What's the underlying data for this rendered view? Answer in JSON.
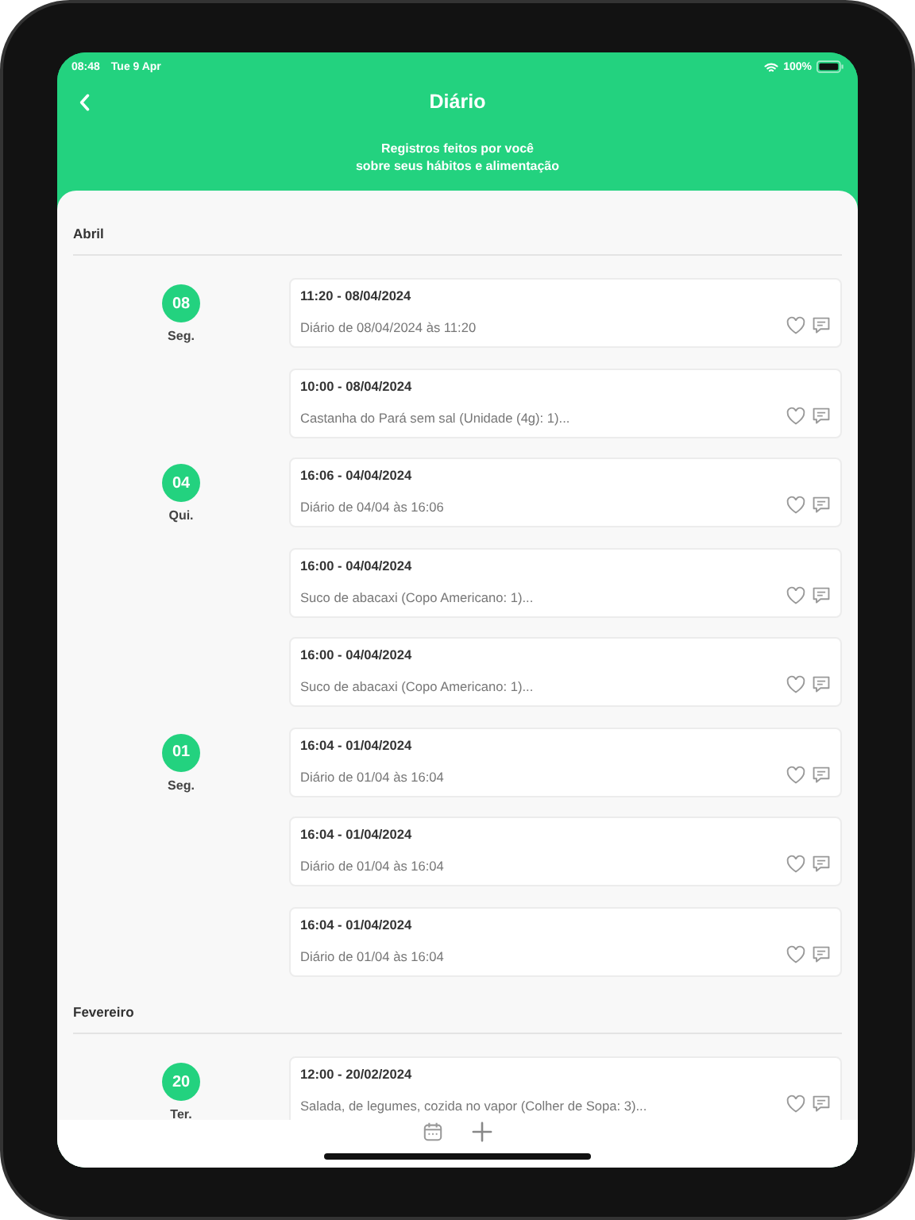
{
  "status_bar": {
    "time": "08:48",
    "date": "Tue 9 Apr",
    "battery": "100%"
  },
  "header": {
    "title": "Diário",
    "subtitle": "Registros feitos por você\nsobre seus hábitos e alimentação"
  },
  "months": [
    {
      "name": "Abril",
      "days": [
        {
          "day": "08",
          "weekday": "Seg.",
          "entries": [
            {
              "title": "11:20 - 08/04/2024",
              "description": "Diário de 08/04/2024 às 11:20"
            },
            {
              "title": "10:00 - 08/04/2024",
              "description": "Castanha do Pará sem sal (Unidade (4g): 1)..."
            }
          ]
        },
        {
          "day": "04",
          "weekday": "Qui.",
          "entries": [
            {
              "title": "16:06 - 04/04/2024",
              "description": "Diário de 04/04 às 16:06"
            },
            {
              "title": "16:00 - 04/04/2024",
              "description": "Suco de abacaxi   (Copo Americano: 1)..."
            },
            {
              "title": "16:00 - 04/04/2024",
              "description": "Suco de abacaxi   (Copo Americano: 1)..."
            }
          ]
        },
        {
          "day": "01",
          "weekday": "Seg.",
          "entries": [
            {
              "title": "16:04 - 01/04/2024",
              "description": "Diário de 01/04 às 16:04"
            },
            {
              "title": "16:04 - 01/04/2024",
              "description": "Diário de 01/04 às 16:04"
            },
            {
              "title": "16:04 - 01/04/2024",
              "description": "Diário de 01/04 às 16:04"
            }
          ]
        }
      ]
    },
    {
      "name": "Fevereiro",
      "days": [
        {
          "day": "20",
          "weekday": "Ter.",
          "entries": [
            {
              "title": "12:00 - 20/02/2024",
              "description": "Salada, de legumes, cozida no vapor (Colher de Sopa: 3)..."
            }
          ]
        }
      ]
    }
  ]
}
